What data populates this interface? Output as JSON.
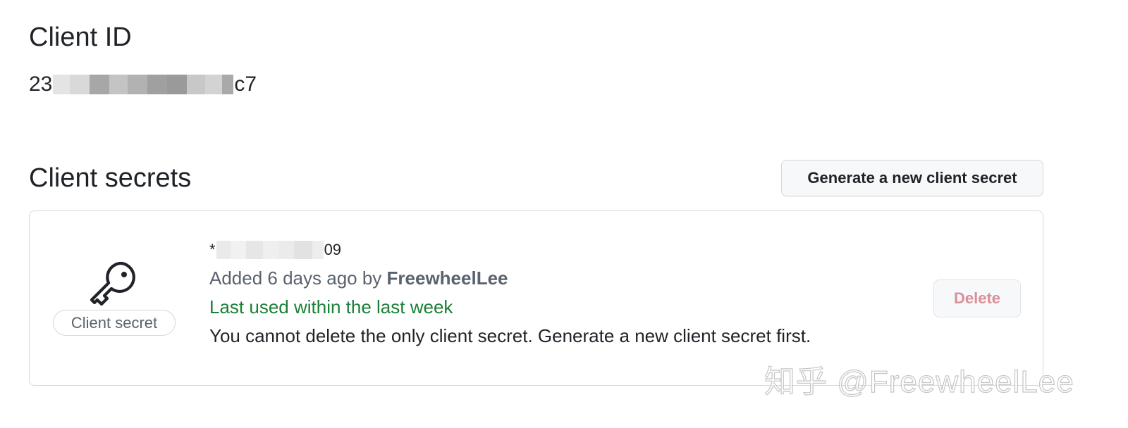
{
  "client_id": {
    "heading": "Client ID",
    "value_prefix": "23",
    "value_suffix": "c7",
    "redacted": true
  },
  "client_secrets": {
    "heading": "Client secrets",
    "generate_button_label": "Generate a new client secret",
    "items": [
      {
        "icon": "key-icon",
        "badge_label": "Client secret",
        "masked_value_prefix": "*",
        "masked_value_suffix": "09",
        "added_prefix": "Added 6 days ago by ",
        "added_by": "FreewheelLee",
        "last_used": "Last used within the last week",
        "warning": "You cannot delete the only client secret. Generate a new client secret first.",
        "delete_label": "Delete",
        "delete_disabled": true
      }
    ]
  },
  "watermark": "知乎 @FreewheelLee",
  "colors": {
    "text_primary": "#1f2328",
    "text_muted": "#59636e",
    "success": "#1a7f37",
    "danger_disabled": "#dc8f98",
    "border": "#d1d9e0",
    "button_bg": "#f6f8fa"
  }
}
